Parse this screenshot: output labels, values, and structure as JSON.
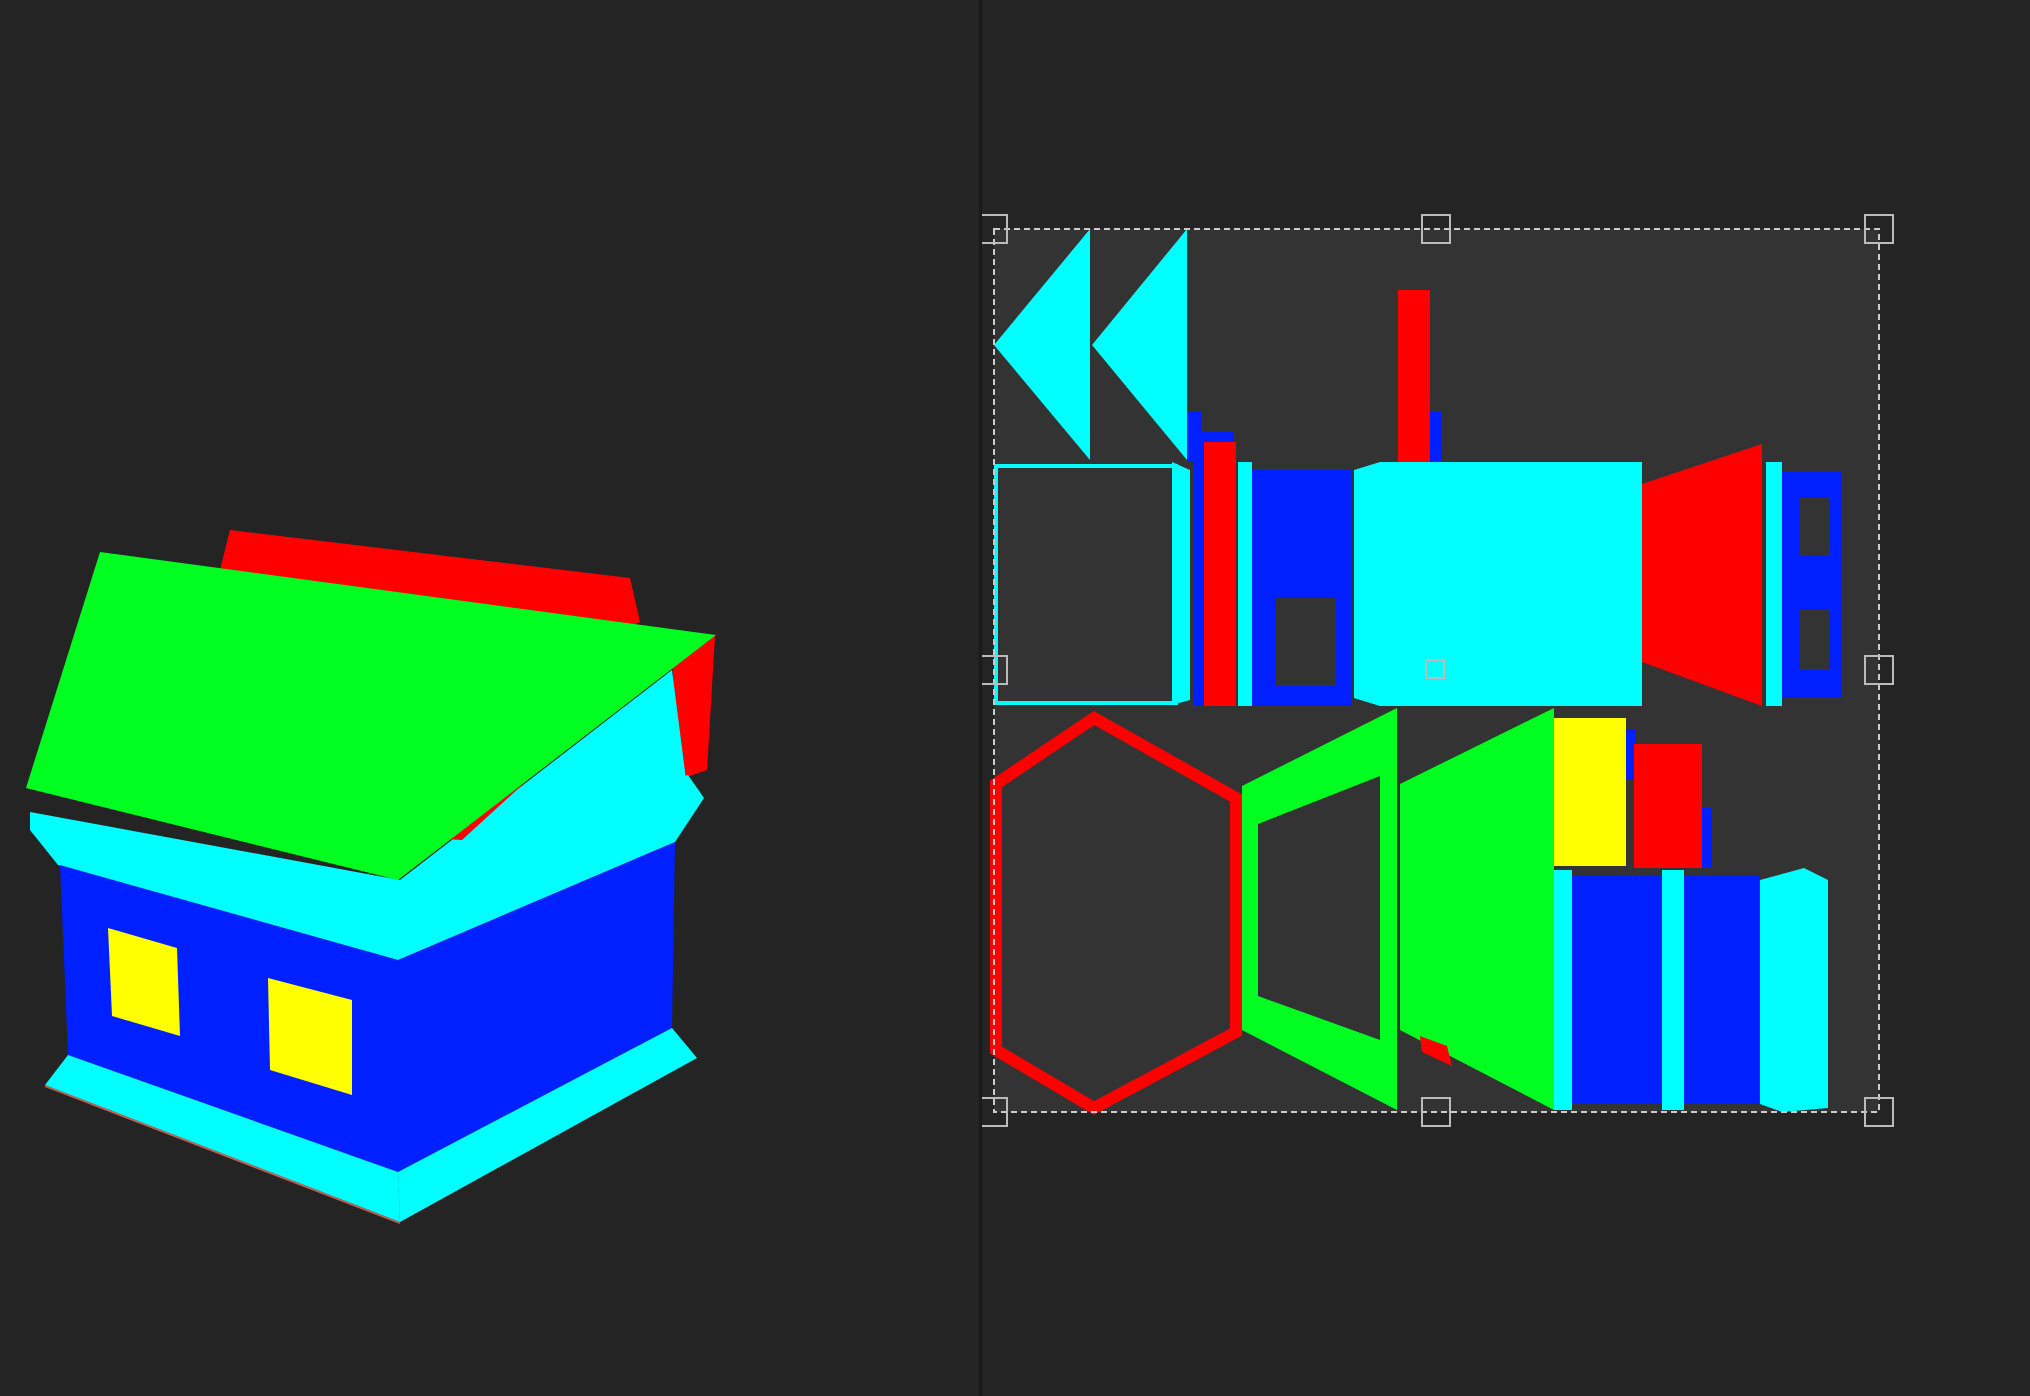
{
  "window": {
    "panes": [
      {
        "name": "3d-viewport",
        "kind": "perspective-preview"
      },
      {
        "name": "uv-editor",
        "kind": "uv-layout"
      }
    ]
  },
  "model": {
    "name": "house",
    "colors": {
      "roof_top": "#00ff20",
      "roof_back": "#ff0000",
      "eaves": "#00ffff",
      "walls": "#0020ff",
      "windows": "#ffff00",
      "base": "#00ffff"
    }
  },
  "uv_editor": {
    "background": "#242424",
    "uv_area_fill": "#333333",
    "selection_box": {
      "style": "dashed",
      "color": "#cccccc",
      "handles": 8
    },
    "islands": [
      "roof-gable-left",
      "roof-gable-right",
      "wall-panel-outline",
      "chimney",
      "side-strips",
      "wall-with-window",
      "roof-front-cyan",
      "roof-red-trapezoid",
      "window-frame-strip",
      "hexagon-ring",
      "green-frame",
      "green-panel",
      "yellow-window",
      "red-block",
      "blue-wall-strips"
    ]
  },
  "theme": {
    "background": "#242424",
    "divider": "#1a1a1a",
    "accent_red": "#ff0000",
    "accent_green": "#00ff20",
    "accent_blue": "#0020ff",
    "accent_cyan": "#00ffff",
    "accent_yellow": "#ffff00"
  }
}
